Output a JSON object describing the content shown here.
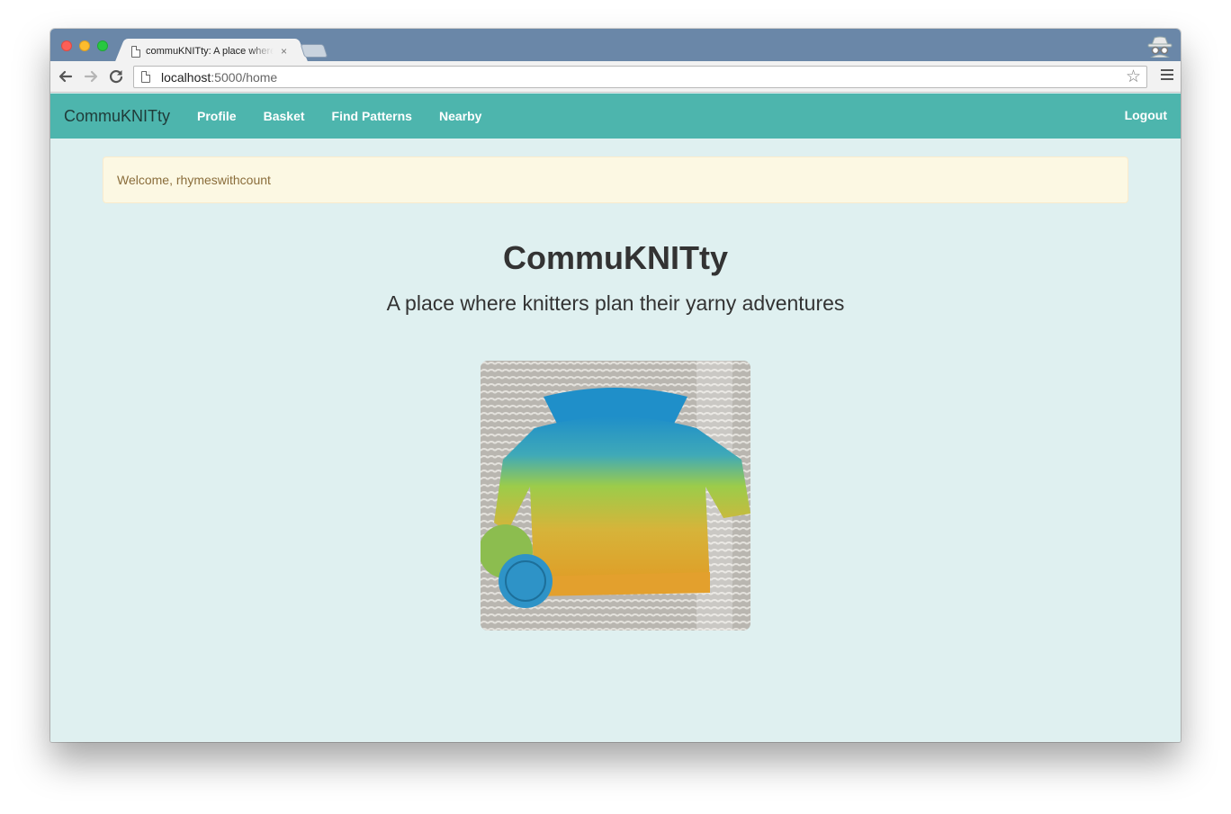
{
  "browser": {
    "tab_title": "commuKNITty: A place where knitters plan their yarny adventures",
    "tab_close": "×",
    "url_host": "localhost",
    "url_path": ":5000/home"
  },
  "navbar": {
    "brand": "CommuKNITty",
    "links": [
      "Profile",
      "Basket",
      "Find Patterns",
      "Nearby"
    ],
    "logout": "Logout"
  },
  "flash": {
    "message": "Welcome, rhymeswithcount"
  },
  "hero": {
    "title": "CommuKNITty",
    "subtitle": "A place where knitters plan their yarny adventures"
  },
  "colors": {
    "navbar": "#4db5ad",
    "page_bg": "#dff0f0",
    "flash_bg": "#fcf8e3"
  }
}
